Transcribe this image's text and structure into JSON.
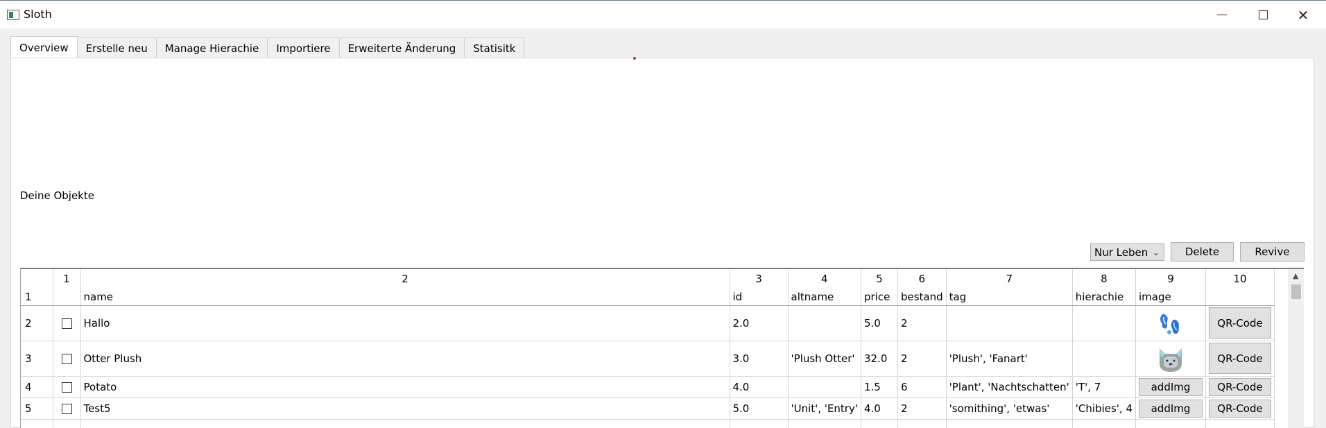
{
  "window": {
    "title": "Sloth"
  },
  "tabs": [
    {
      "label": "Overview",
      "active": true
    },
    {
      "label": "Erstelle neu"
    },
    {
      "label": "Manage Hierachie"
    },
    {
      "label": "Importiere"
    },
    {
      "label": "Erweiterte Änderung"
    },
    {
      "label": "Statisitk"
    }
  ],
  "overview": {
    "section_label": "Deine Objekte",
    "filter": {
      "selected": "Nur Lebendig"
    },
    "delete_label": "Delete",
    "revive_label": "Revive"
  },
  "table": {
    "column_numbers": [
      "1",
      "2",
      "3",
      "4",
      "5",
      "6",
      "7",
      "8",
      "9",
      "10"
    ],
    "field_row_number": "1",
    "fields": [
      "",
      "name",
      "id",
      "altname",
      "price",
      "bestand",
      "tag",
      "hierachie",
      "image",
      ""
    ],
    "rows": [
      {
        "num": "2",
        "name": "Hallo",
        "id": "2.0",
        "altname": "",
        "price": "5.0",
        "bestand": "2",
        "tag": "",
        "hierachie": "",
        "image": "blue-figures-thumbnail",
        "qr": "QR-Code"
      },
      {
        "num": "3",
        "name": "Otter Plush",
        "id": "3.0",
        "altname": "'Plush Otter'",
        "price": "32.0",
        "bestand": "2",
        "tag": "'Plush', 'Fanart'",
        "hierachie": "",
        "image": "otter-plush-thumbnail",
        "qr": "QR-Code"
      },
      {
        "num": "4",
        "name": "Potato",
        "id": "4.0",
        "altname": "",
        "price": "1.5",
        "bestand": "6",
        "tag": "'Plant', 'Nachtschatten'",
        "hierachie": "'T', 7",
        "image_button": "addImg",
        "qr": "QR-Code"
      },
      {
        "num": "5",
        "name": "Test5",
        "id": "5.0",
        "altname": "'Unit', 'Entry'",
        "price": "4.0",
        "bestand": "2",
        "tag": "'somithing', 'etwas'",
        "hierachie": "'Chibies', 4",
        "image_button": "addImg",
        "qr": "QR-Code"
      }
    ]
  },
  "colors": {
    "titlebar": "#ffffff",
    "window_bg": "#f0f0f0",
    "button_bg": "#e1e1e1",
    "marker": "#e02020"
  }
}
